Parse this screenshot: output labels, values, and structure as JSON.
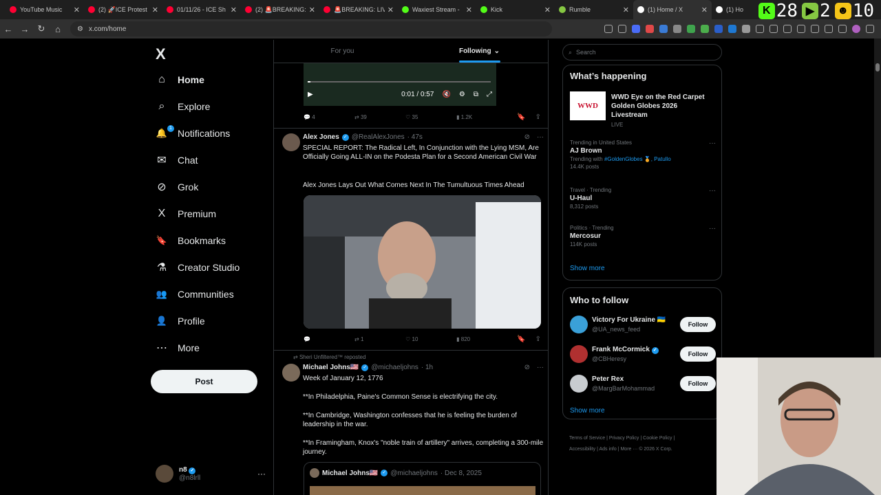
{
  "browser": {
    "tabs": [
      {
        "label": "YouTube Music",
        "favicon_color": "#ff0033"
      },
      {
        "label": "(2) 🚀ICE Protest",
        "favicon_color": "#ff0033"
      },
      {
        "label": "01/11/26 - ICE Sh",
        "favicon_color": "#ff0033"
      },
      {
        "label": "(2) 🚨BREAKING:",
        "favicon_color": "#ff0033"
      },
      {
        "label": "🚨BREAKING: LIV",
        "favicon_color": "#ff0033"
      },
      {
        "label": "Waxiest Stream -",
        "favicon_color": "#53fc18"
      },
      {
        "label": "Kick",
        "favicon_color": "#53fc18"
      },
      {
        "label": "Rumble",
        "favicon_color": "#85c742"
      },
      {
        "label": "(1) Home / X",
        "favicon_color": "#ffffff"
      },
      {
        "label": "(1) Ho",
        "favicon_color": "#ffffff"
      }
    ],
    "url": "x.com/home",
    "overlay": {
      "kick_count": "28",
      "rumble_count": "2",
      "other_count": "10"
    }
  },
  "nav": {
    "logo": "X",
    "items": [
      {
        "label": "Home",
        "icon": "⌂"
      },
      {
        "label": "Explore",
        "icon": "⌕"
      },
      {
        "label": "Notifications",
        "icon": "🔔",
        "badge": "1"
      },
      {
        "label": "Chat",
        "icon": "✉"
      },
      {
        "label": "Grok",
        "icon": "⊘"
      },
      {
        "label": "Premium",
        "icon": "X"
      },
      {
        "label": "Bookmarks",
        "icon": "🔖"
      },
      {
        "label": "Creator Studio",
        "icon": "⚗"
      },
      {
        "label": "Communities",
        "icon": "👥"
      },
      {
        "label": "Profile",
        "icon": "👤"
      },
      {
        "label": "More",
        "icon": "⋯"
      }
    ],
    "post_label": "Post",
    "account": {
      "name": "n8",
      "handle": "@n8lrll"
    }
  },
  "feed": {
    "tabs": [
      "For you",
      "Following"
    ],
    "video1": {
      "time": "0:01 / 0:57"
    },
    "actions1": {
      "replies": "4",
      "reposts": "39",
      "likes": "35",
      "views": "1.2K"
    },
    "tweet1": {
      "name": "Alex Jones",
      "handle": "@RealAlexJones",
      "time": "· 47s",
      "text": "SPECIAL REPORT: The Radical Left, In Conjunction with the Lying MSM, Are Officially Going ALL-IN on the Podesta Plan for a Second American Civil War",
      "text2": "Alex Jones Lays Out What Comes Next In The Tumultuous Times Ahead"
    },
    "actions2": {
      "replies": "",
      "reposts": "1",
      "likes": "10",
      "views": "820"
    },
    "tweet2": {
      "reposted_by": "Sheri Unfiltered™ reposted",
      "name": "Michael Johns🇺🇸",
      "handle": "@michaeljohns",
      "time": "· 1h",
      "lines": [
        "Week of January 12, 1776",
        "**In Philadelphia, Paine's Common Sense is electrifying the city.",
        "**In Cambridge, Washington confesses that he is feeling the burden of leadership in the war.",
        "**In Framingham, Knox's \"noble train of artillery\" arrives, completing a 300-mile journey."
      ],
      "quote": {
        "name": "Michael Johns🇺🇸",
        "handle": "@michaeljohns",
        "time": "· Dec 8, 2025"
      }
    }
  },
  "right": {
    "search_placeholder": "Search",
    "happening_title": "What’s happening",
    "event": {
      "title": "WWD Eye on the Red Carpet Golden Globes 2026 Livestream",
      "status": "LIVE",
      "logo": "WWD"
    },
    "trends": [
      {
        "context": "Trending in United States",
        "title": "AJ Brown",
        "with_label": "Trending with",
        "with_links": "#GoldenGlobes 🏅, Patullo",
        "count": "14.4K posts"
      },
      {
        "context": "Travel · Trending",
        "title": "U-Haul",
        "count": "8,312 posts"
      },
      {
        "context": "Politics · Trending",
        "title": "Mercosur",
        "count": "114K posts"
      }
    ],
    "show_more": "Show more",
    "who_title": "Who to follow",
    "follow": [
      {
        "name": "Victory For Ukraine 🇺🇦",
        "handle": "@UA_news_feed",
        "btn": "Follow",
        "color": "#3aa0d8"
      },
      {
        "name": "Frank McCormick",
        "handle": "@CBHeresy",
        "btn": "Follow",
        "color": "#b03030"
      },
      {
        "name": "Peter Rex",
        "handle": "@MargBarMohammad",
        "btn": "Follow",
        "color": "#c8ccd0"
      }
    ],
    "show_more2": "Show more",
    "footer": [
      "Terms of Service",
      "Privacy Policy",
      "Cookie Policy",
      "Accessibility",
      "Ads info",
      "More ···",
      "© 2026 X Corp."
    ]
  },
  "colors": {
    "accent": "#1d9bf0",
    "bg": "#000000",
    "border": "#2f3336"
  }
}
